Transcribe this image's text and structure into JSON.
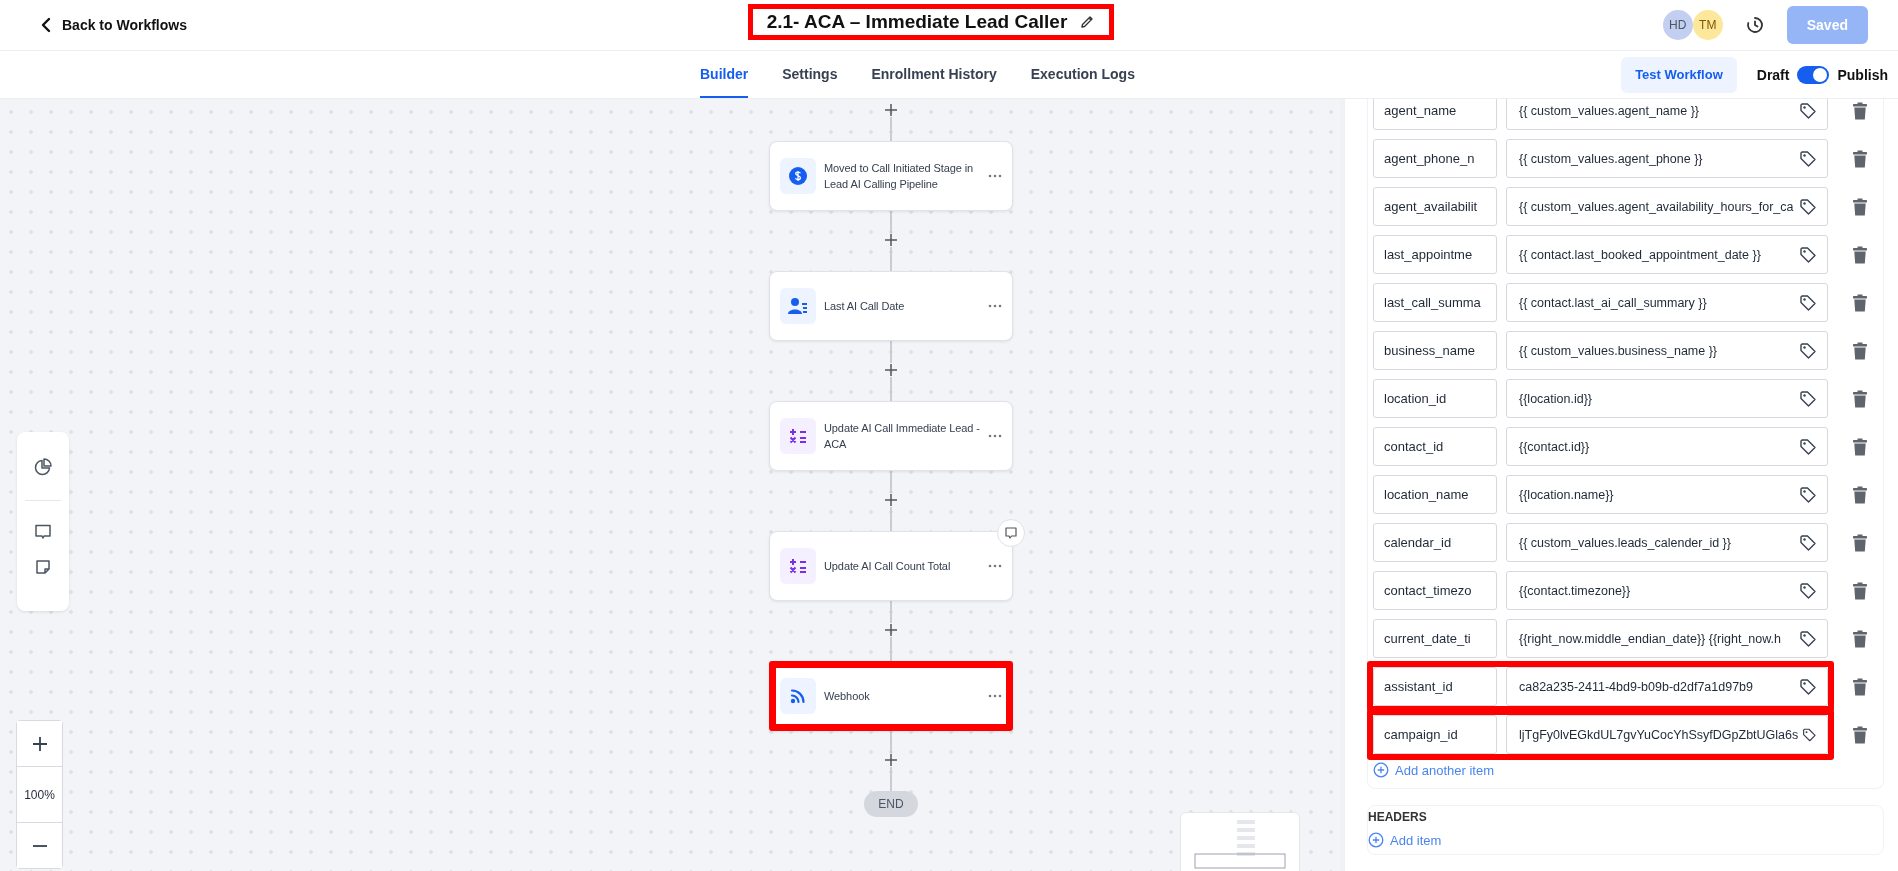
{
  "header": {
    "back_link": "Back to Workflows",
    "title": {
      "text": "2.1- ACA – Immediate Lead Caller",
      "highlighted": true
    },
    "avatars": [
      {
        "initials": "HD",
        "color": "#c3cff0"
      },
      {
        "initials": "TM",
        "color": "#fce79a"
      }
    ],
    "save_button": {
      "label": "Saved",
      "disabled": true
    }
  },
  "tabs": [
    {
      "label": "Builder",
      "selected": true
    },
    {
      "label": "Settings",
      "selected": false
    },
    {
      "label": "Enrollment History",
      "selected": false
    },
    {
      "label": "Execution Logs",
      "selected": false
    }
  ],
  "test_button": "Test Workflow",
  "publish_toggle": {
    "left_label": "Draft",
    "right_label": "Publish",
    "on": true
  },
  "flow": {
    "nodes": [
      {
        "kind": "trigger",
        "label": "Moved to Call Initiated Stage in Lead AI Calling Pipeline",
        "has_comment": false,
        "highlighted": false
      },
      {
        "kind": "contact",
        "label": "Last AI Call Date",
        "has_comment": false,
        "highlighted": false
      },
      {
        "kind": "math",
        "label": "Update AI Call Immediate Lead - ACA",
        "has_comment": false,
        "highlighted": false
      },
      {
        "kind": "math",
        "label": "Update AI Call Count Total",
        "has_comment": true,
        "highlighted": false
      },
      {
        "kind": "webhook",
        "label": "Webhook",
        "has_comment": false,
        "highlighted": true
      }
    ],
    "end_label": "END"
  },
  "zoom": {
    "level_text": "100%"
  },
  "panel": {
    "rows": [
      {
        "key": "agent_name",
        "value": "{{ custom_values.agent_name }}",
        "highlighted": false
      },
      {
        "key": "agent_phone_n",
        "value": "{{ custom_values.agent_phone }}",
        "highlighted": false
      },
      {
        "key": "agent_availabilit",
        "value": "{{ custom_values.agent_availability_hours_for_ca",
        "highlighted": false
      },
      {
        "key": "last_appointme",
        "value": "{{ contact.last_booked_appointment_date }}",
        "highlighted": false
      },
      {
        "key": "last_call_summa",
        "value": "{{ contact.last_ai_call_summary }}",
        "highlighted": false
      },
      {
        "key": "business_name",
        "value": "{{ custom_values.business_name }}",
        "highlighted": false
      },
      {
        "key": "location_id",
        "value": "{{location.id}}",
        "highlighted": false
      },
      {
        "key": "contact_id",
        "value": "{{contact.id}}",
        "highlighted": false
      },
      {
        "key": "location_name",
        "value": "{{location.name}}",
        "highlighted": false
      },
      {
        "key": "calendar_id",
        "value": "{{ custom_values.leads_calender_id }}",
        "highlighted": false
      },
      {
        "key": "contact_timezo",
        "value": "{{contact.timezone}}",
        "highlighted": false
      },
      {
        "key": "current_date_ti",
        "value": "{{right_now.middle_endian_date}} {{right_now.h",
        "highlighted": false
      },
      {
        "key": "assistant_id",
        "value": "ca82a235-2411-4bd9-b09b-d2df7a1d97b9",
        "highlighted": true
      },
      {
        "key": "campaign_id",
        "value": "ljTgFy0lvEGkdUL7gvYuCocYhSsyfDGpZbtUGla6s",
        "highlighted": true
      }
    ],
    "add_row": "Add another item",
    "headers": {
      "title": "HEADERS",
      "add": "Add item"
    }
  }
}
